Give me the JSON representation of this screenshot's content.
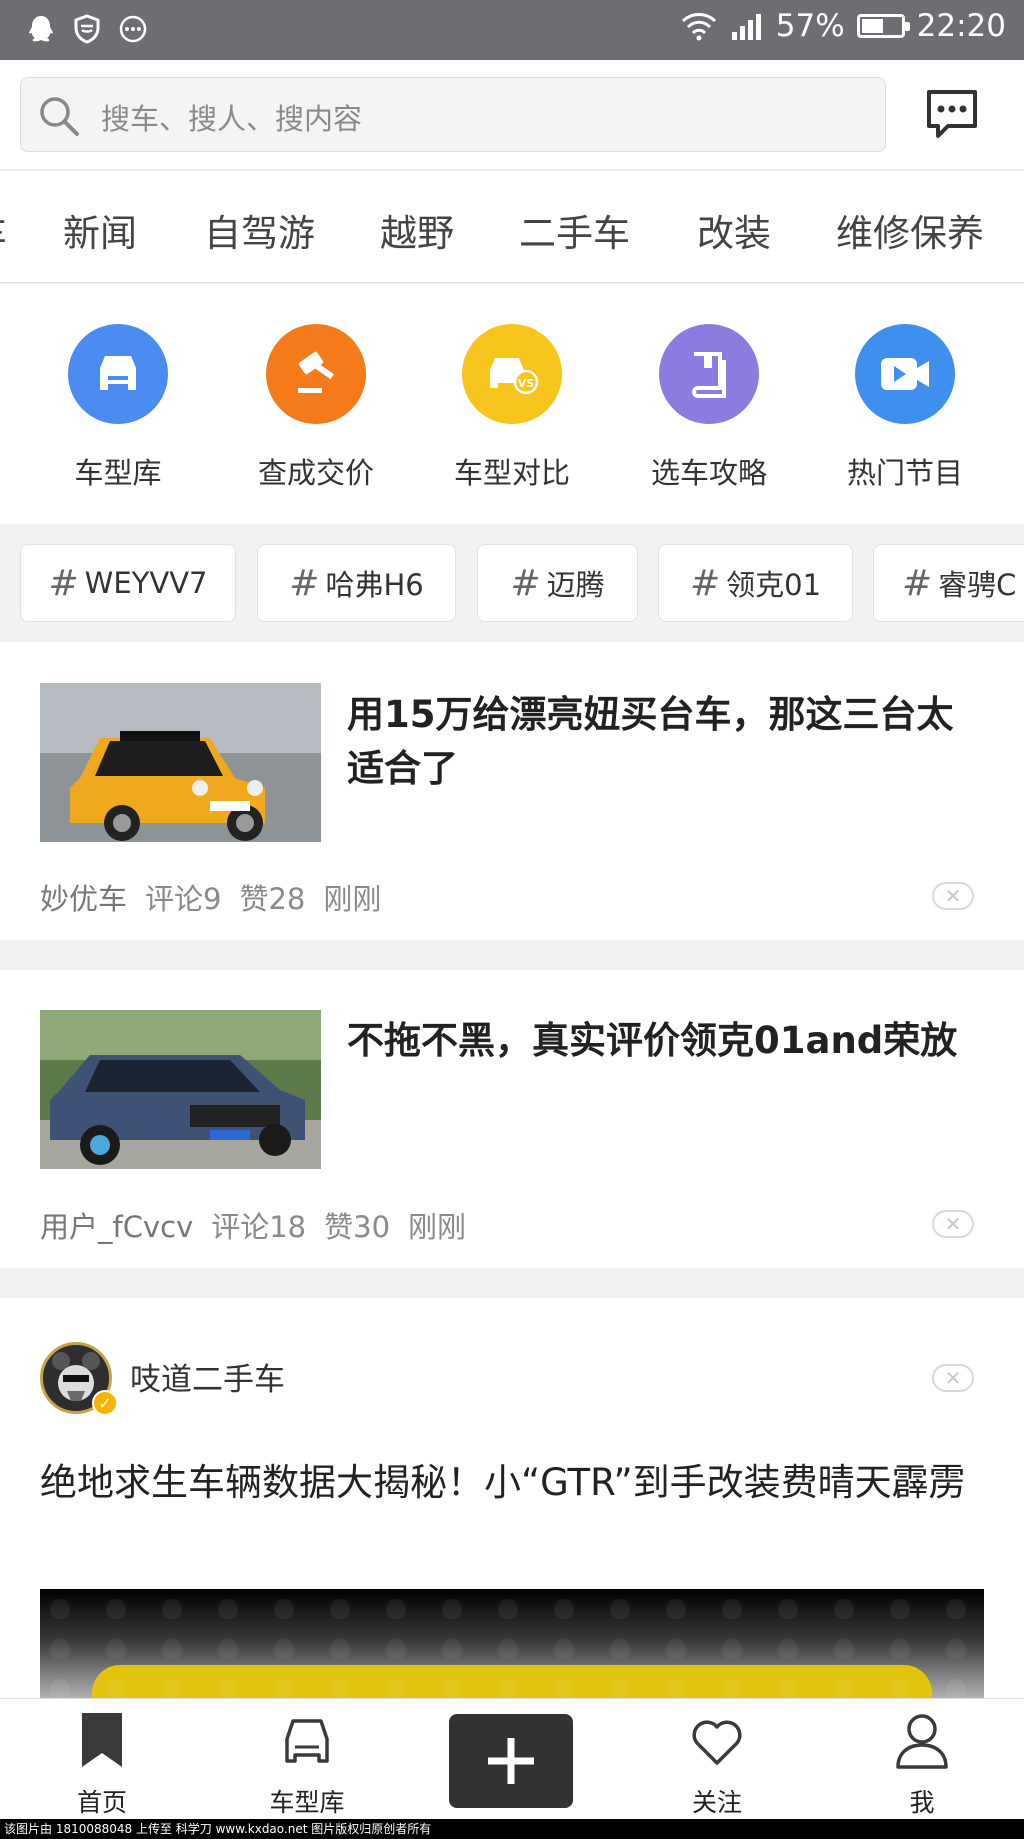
{
  "status_bar": {
    "battery": "57%",
    "battery_level": 0.57,
    "time": "22:20"
  },
  "search": {
    "placeholder": "搜车、搜人、搜内容"
  },
  "categories": [
    "车",
    "新闻",
    "自驾游",
    "越野",
    "二手车",
    "改装",
    "维修保养"
  ],
  "shortcuts": [
    {
      "label": "车型库",
      "color": "#4a8cf0",
      "icon": "car-front-icon"
    },
    {
      "label": "查成交价",
      "color": "#f57a1a",
      "icon": "gavel-icon"
    },
    {
      "label": "车型对比",
      "color": "#f7c51c",
      "icon": "car-vs-icon"
    },
    {
      "label": "选车攻略",
      "color": "#8b7de0",
      "icon": "book-icon"
    },
    {
      "label": "热门节目",
      "color": "#3f8fee",
      "icon": "video-icon"
    }
  ],
  "hashtags": [
    "WEYVV7",
    "哈弗H6",
    "迈腾",
    "领克01",
    "睿骋C"
  ],
  "feed": [
    {
      "title": "用15万给漂亮妞买台车，那这三台太适合了",
      "author": "妙优车",
      "comments": "评论9",
      "likes": "赞28",
      "time": "刚刚"
    },
    {
      "title": "不拖不黑，真实评价领克01and荣放",
      "author": "用户_fCvcv",
      "comments": "评论18",
      "likes": "赞30",
      "time": "刚刚"
    },
    {
      "account": "吱道二手车",
      "title": "绝地求生车辆数据大揭秘！小“GTR”到手改装费晴天霹雳"
    }
  ],
  "bottom_nav": {
    "home": "首页",
    "cars": "车型库",
    "follow": "关注",
    "me": "我"
  },
  "watermark": "该图片由 1810088048 上传至 科学刀 www.kxdao.net 图片版权归原创者所有"
}
